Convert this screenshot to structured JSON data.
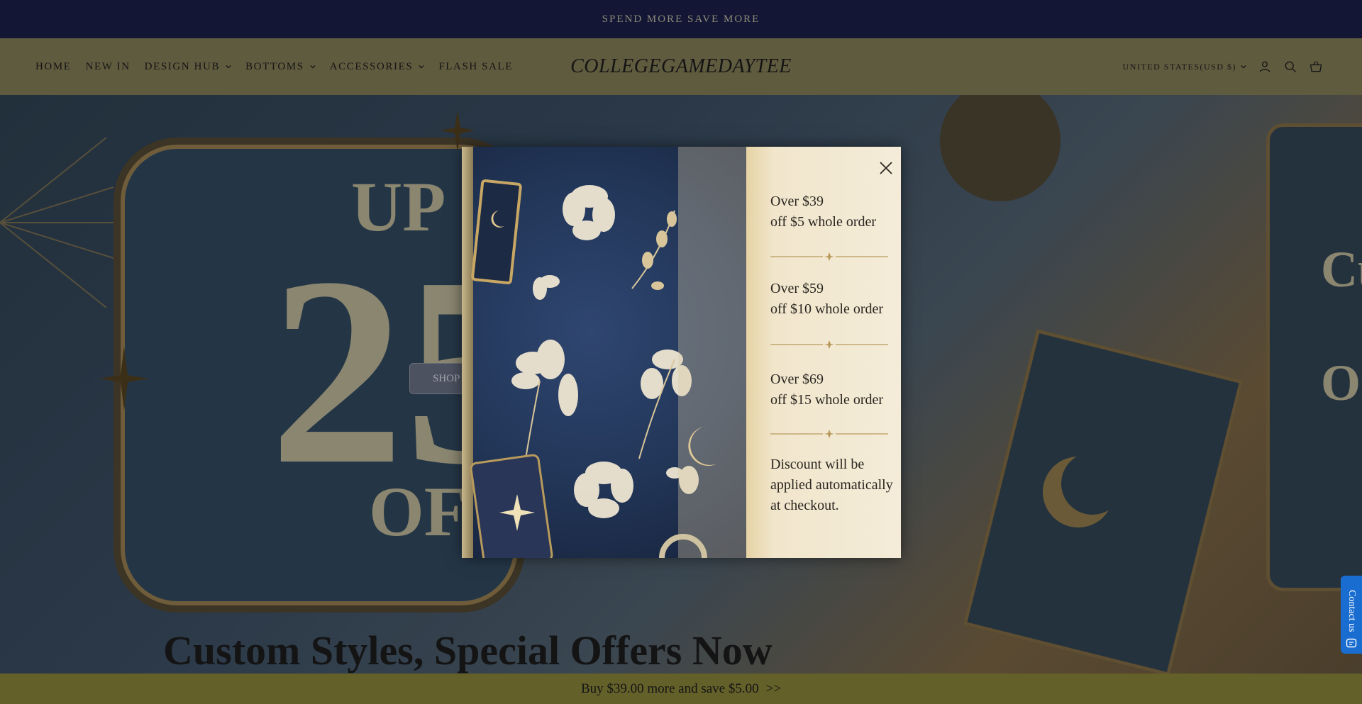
{
  "announcement": "SPEND MORE SAVE MORE",
  "nav": {
    "items": [
      {
        "label": "HOME",
        "has_dropdown": false
      },
      {
        "label": "NEW IN",
        "has_dropdown": false
      },
      {
        "label": "DESIGN HUB",
        "has_dropdown": true
      },
      {
        "label": "BOTTOMS",
        "has_dropdown": true
      },
      {
        "label": "ACCESSORIES",
        "has_dropdown": true
      },
      {
        "label": "FLASH SALE",
        "has_dropdown": false
      }
    ]
  },
  "logo": "COLLEGEGAMEDAYTEE",
  "header_right": {
    "currency": "UNITED STATES(USD $)",
    "icons": [
      "account-icon",
      "search-icon",
      "cart-icon"
    ]
  },
  "hero": {
    "up_text": "UP",
    "big_number": "25",
    "off_text": "OFF",
    "shop_button": "SHOP",
    "tagline": "Custom Styles, Special Offers Now",
    "right_text_1": "Cu",
    "right_text_2": "On"
  },
  "modal": {
    "offers": [
      {
        "line1": "Over $39",
        "line2": "off $5 whole order"
      },
      {
        "line1": "Over $59",
        "line2": "off $10 whole order"
      },
      {
        "line1": "Over $69",
        "line2": "off $15 whole order"
      }
    ],
    "note_lines": [
      "Discount will be",
      "applied automatically",
      "at checkout."
    ],
    "close_icon": "close-icon"
  },
  "bottom_bar": {
    "text": "Buy $39.00 more and save $5.00",
    "arrows": ">>"
  },
  "contact": {
    "label": "Contact us",
    "icon": "chat-icon"
  },
  "colors": {
    "announcement_bg": "#131735",
    "header_bg": "#5f5b3f",
    "bottom_bar_bg": "#63602a",
    "contact_bg": "#1a6dd0"
  }
}
